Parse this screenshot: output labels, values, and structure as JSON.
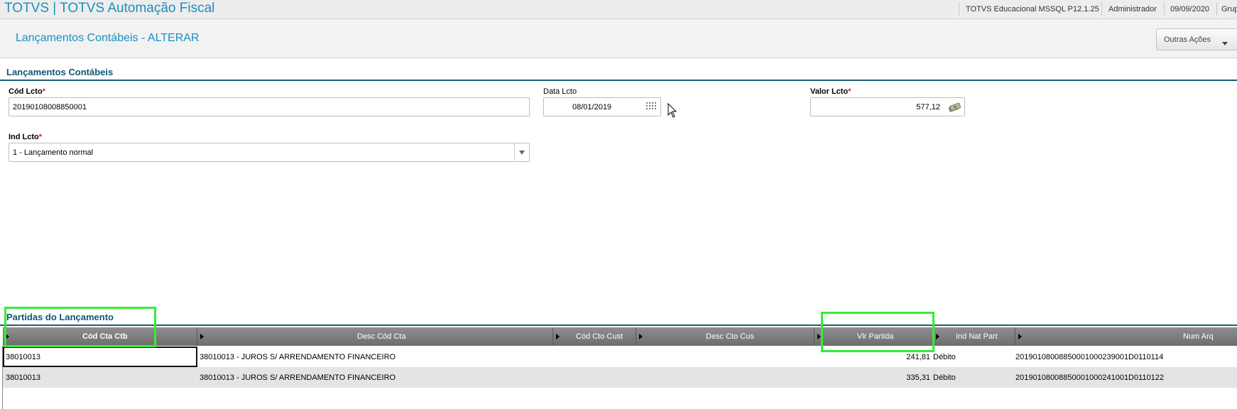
{
  "topbar": {
    "app_title": "TOTVS | TOTVS Automação Fiscal",
    "environment": "TOTVS Educacional MSSQL P12.1.25",
    "user": "Administrador",
    "date": "09/09/2020",
    "group": "Grup"
  },
  "header": {
    "page_title": "Lançamentos Contábeis - ALTERAR",
    "outras_acoes_label": "Outras Ações"
  },
  "form": {
    "section_title": "Lançamentos Contábeis",
    "cod_lcto": {
      "label": "Cód Lcto",
      "required_mark": "*",
      "value": "20190108008850001"
    },
    "data_lcto": {
      "label": "Data Lcto",
      "value": "08/01/2019"
    },
    "valor_lcto": {
      "label": "Valor Lcto",
      "required_mark": "*",
      "value": "577,12"
    },
    "ind_lcto": {
      "label": "Ind Lcto",
      "required_mark": "*",
      "value": "1 - Lançamento normal"
    }
  },
  "grid": {
    "section_title": "Partidas do Lançamento",
    "columns": [
      "Cód Cta Ctb",
      "Desc Cód Cta",
      "Cód Cto Cust",
      "Desc Cto Cus",
      "Vlr Partida",
      "Ind Nat Part",
      "Num Arq"
    ],
    "rows": [
      {
        "cod_cta": "38010013",
        "desc_cod_cta": "38010013 - JUROS S/ ARRENDAMENTO FINANCEIRO",
        "cod_cto_cust": "",
        "desc_cto_cus": "",
        "vlr_partida": "241,81",
        "ind_nat_part": "Débito",
        "num_arq": "20190108008850001000239001D0110114"
      },
      {
        "cod_cta": "38010013",
        "desc_cod_cta": "38010013 - JUROS S/ ARRENDAMENTO FINANCEIRO",
        "cod_cto_cust": "",
        "desc_cto_cus": "",
        "vlr_partida": "335,31",
        "ind_nat_part": "Débito",
        "num_arq": "20190108008850001000241001D0110122"
      }
    ]
  },
  "colors": {
    "accent": "#1a8fc0",
    "section": "#0f5776",
    "highlight": "#33ee33",
    "required": "#e02020"
  }
}
